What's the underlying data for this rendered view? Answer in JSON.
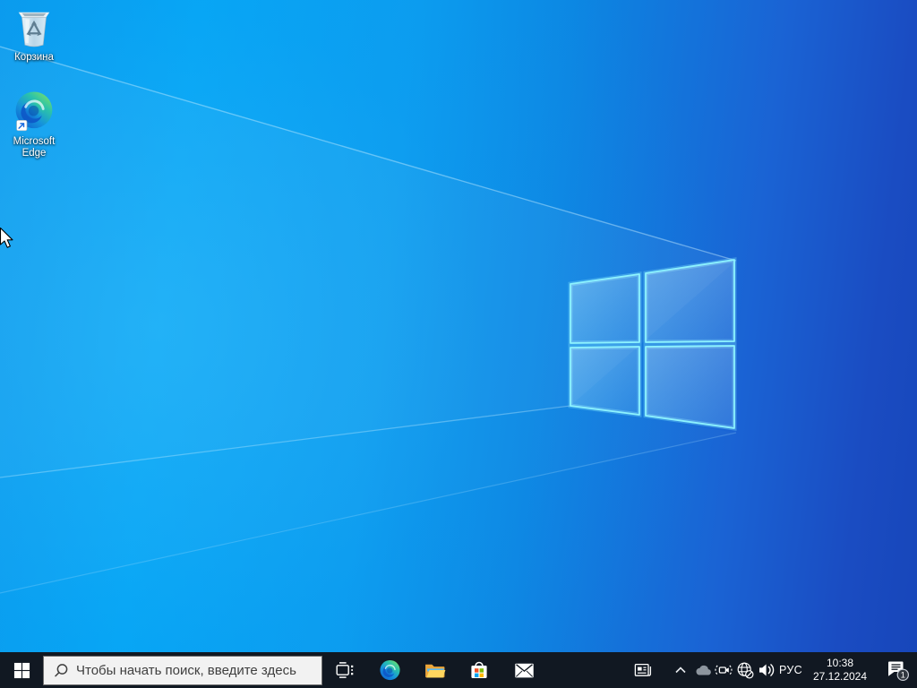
{
  "desktop": {
    "icons": [
      {
        "id": "recycle-bin",
        "label": "Корзина"
      },
      {
        "id": "microsoft-edge",
        "label": "Microsoft Edge"
      }
    ]
  },
  "taskbar": {
    "start": {
      "icon": "windows-logo-icon"
    },
    "search": {
      "placeholder": "Чтобы начать поиск, введите здесь",
      "icon": "search-icon"
    },
    "apps": [
      {
        "icon": "task-view-icon"
      },
      {
        "icon": "edge-icon"
      },
      {
        "icon": "file-explorer-icon"
      },
      {
        "icon": "microsoft-store-icon"
      },
      {
        "icon": "mail-icon"
      }
    ],
    "tray": {
      "icons": [
        "news-and-interests-icon",
        "hidden-icons-chevron-icon",
        "onedrive-cloud-icon",
        "meet-now-icon",
        "network-offline-globe-icon",
        "volume-icon"
      ],
      "language": "РУС",
      "clock": {
        "time": "10:38",
        "date": "27.12.2024"
      },
      "notifications": {
        "badge": "1",
        "icon": "action-center-icon"
      }
    }
  },
  "colors": {
    "taskbar_bg": "#111822",
    "wallpaper_left": "#04a5f4",
    "wallpaper_right": "#1746ba",
    "logo_edge_glow": "#8df3ff",
    "search_bg": "#f2f2f2",
    "search_text": "#3f3f3f"
  }
}
